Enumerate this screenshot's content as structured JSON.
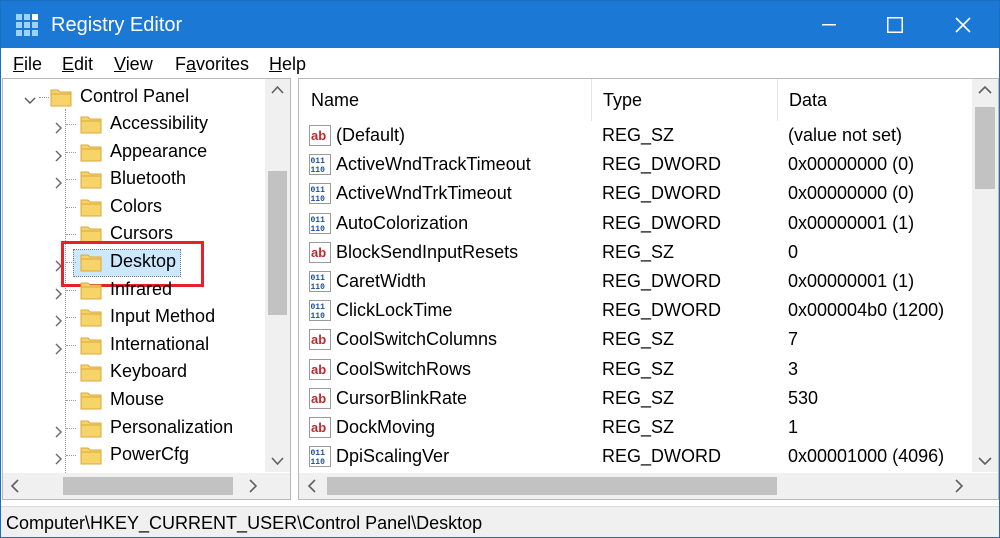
{
  "window": {
    "title": "Registry Editor"
  },
  "menu": {
    "file": {
      "ul": "F",
      "rest": "ile"
    },
    "edit": {
      "ul": "E",
      "rest": "dit"
    },
    "view": {
      "ul": "V",
      "rest": "iew"
    },
    "favorites": {
      "pre": "F",
      "ul": "a",
      "rest": "vorites"
    },
    "help": {
      "ul": "H",
      "rest": "elp"
    }
  },
  "tree": {
    "parent": "Control Panel",
    "items": [
      {
        "label": "Accessibility",
        "expandable": true
      },
      {
        "label": "Appearance",
        "expandable": true
      },
      {
        "label": "Bluetooth",
        "expandable": true
      },
      {
        "label": "Colors",
        "expandable": false
      },
      {
        "label": "Cursors",
        "expandable": false
      },
      {
        "label": "Desktop",
        "expandable": true,
        "selected": true
      },
      {
        "label": "Infrared",
        "expandable": true
      },
      {
        "label": "Input Method",
        "expandable": true
      },
      {
        "label": "International",
        "expandable": true
      },
      {
        "label": "Keyboard",
        "expandable": false
      },
      {
        "label": "Mouse",
        "expandable": false
      },
      {
        "label": "Personalization",
        "expandable": true
      },
      {
        "label": "PowerCfg",
        "expandable": true
      }
    ]
  },
  "values": {
    "columns": {
      "name": "Name",
      "type": "Type",
      "data": "Data"
    },
    "rows": [
      {
        "icon": "string-value-icon",
        "name": "(Default)",
        "type": "REG_SZ",
        "data": "(value not set)"
      },
      {
        "icon": "dword-value-icon",
        "name": "ActiveWndTrackTimeout",
        "type": "REG_DWORD",
        "data": "0x00000000 (0)"
      },
      {
        "icon": "dword-value-icon",
        "name": "ActiveWndTrkTimeout",
        "type": "REG_DWORD",
        "data": "0x00000000 (0)"
      },
      {
        "icon": "dword-value-icon",
        "name": "AutoColorization",
        "type": "REG_DWORD",
        "data": "0x00000001 (1)"
      },
      {
        "icon": "string-value-icon",
        "name": "BlockSendInputResets",
        "type": "REG_SZ",
        "data": "0"
      },
      {
        "icon": "dword-value-icon",
        "name": "CaretWidth",
        "type": "REG_DWORD",
        "data": "0x00000001 (1)"
      },
      {
        "icon": "dword-value-icon",
        "name": "ClickLockTime",
        "type": "REG_DWORD",
        "data": "0x000004b0 (1200)"
      },
      {
        "icon": "string-value-icon",
        "name": "CoolSwitchColumns",
        "type": "REG_SZ",
        "data": "7"
      },
      {
        "icon": "string-value-icon",
        "name": "CoolSwitchRows",
        "type": "REG_SZ",
        "data": "3"
      },
      {
        "icon": "string-value-icon",
        "name": "CursorBlinkRate",
        "type": "REG_SZ",
        "data": "530"
      },
      {
        "icon": "string-value-icon",
        "name": "DockMoving",
        "type": "REG_SZ",
        "data": "1"
      },
      {
        "icon": "dword-value-icon",
        "name": "DpiScalingVer",
        "type": "REG_DWORD",
        "data": "0x00001000 (4096)"
      }
    ]
  },
  "status": {
    "path": "Computer\\HKEY_CURRENT_USER\\Control Panel\\Desktop"
  },
  "colors": {
    "titlebar": "#1b78d4",
    "selection": "#cce8ff",
    "highlight_box": "#e8202a",
    "folder": "#f7d46a"
  }
}
